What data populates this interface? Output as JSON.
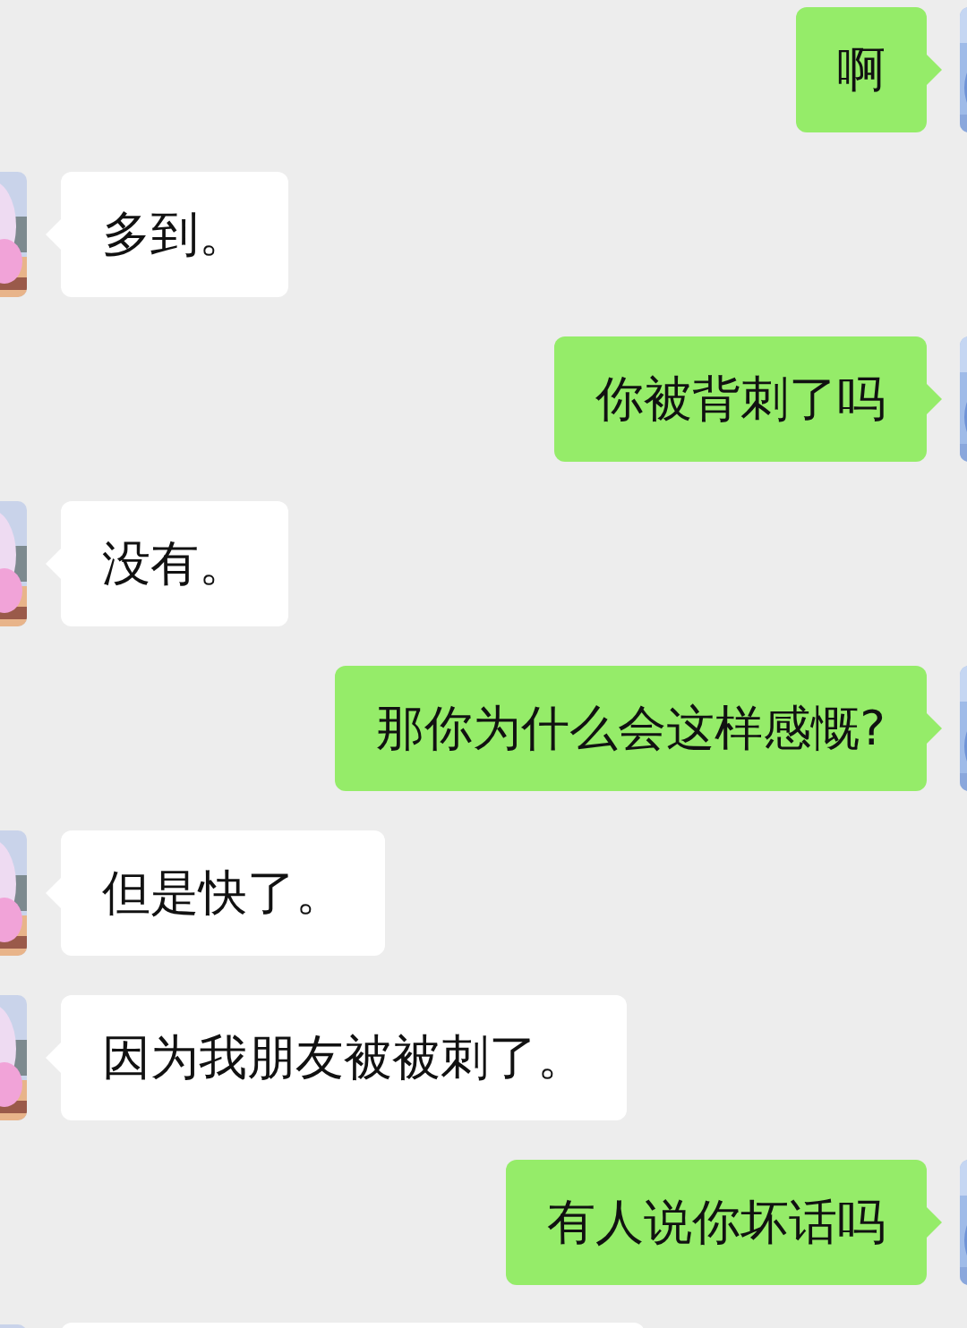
{
  "messages": [
    {
      "outgoing": true,
      "kind": "text",
      "text": "啊"
    },
    {
      "outgoing": false,
      "kind": "text",
      "text": "多到。"
    },
    {
      "outgoing": true,
      "kind": "text",
      "text": "你被背刺了吗"
    },
    {
      "outgoing": false,
      "kind": "text",
      "text": "没有。"
    },
    {
      "outgoing": true,
      "kind": "text",
      "text": "那你为什么会这样感慨?"
    },
    {
      "outgoing": false,
      "kind": "text",
      "text": "但是快了。"
    },
    {
      "outgoing": false,
      "kind": "text",
      "text": "因为我朋友被被刺了。"
    },
    {
      "outgoing": true,
      "kind": "text",
      "text": "有人说你坏话吗"
    },
    {
      "outgoing": false,
      "kind": "cut"
    }
  ]
}
